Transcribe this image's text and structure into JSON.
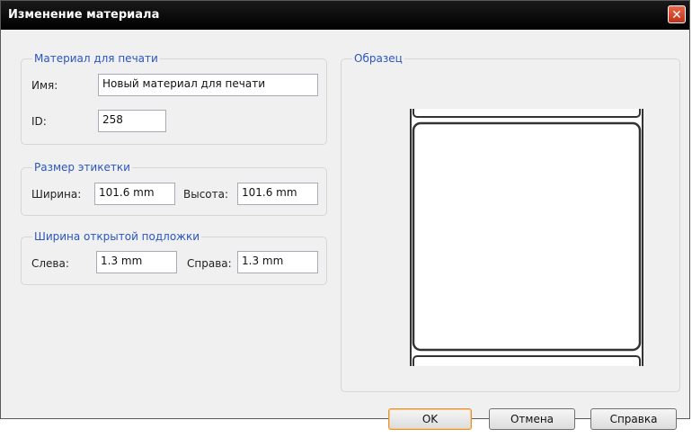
{
  "dialog": {
    "title": "Изменение материала"
  },
  "material_group": {
    "legend": "Материал для печати",
    "name_label": "Имя:",
    "name_value": "Новый материал для печати",
    "id_label": "ID:",
    "id_value": "258"
  },
  "label_size_group": {
    "legend": "Размер этикетки",
    "width_label": "Ширина:",
    "width_value": "101.6 mm",
    "height_label": "Высота:",
    "height_value": "101.6 mm"
  },
  "liner_group": {
    "legend": "Ширина открытой подложки",
    "left_label": "Слева:",
    "left_value": "1.3 mm",
    "right_label": "Справа:",
    "right_value": "1.3 mm"
  },
  "sample_group": {
    "legend": "Образец"
  },
  "buttons": {
    "ok": "OK",
    "cancel": "Отмена",
    "help": "Справка"
  },
  "icons": {
    "close": "close-icon"
  }
}
